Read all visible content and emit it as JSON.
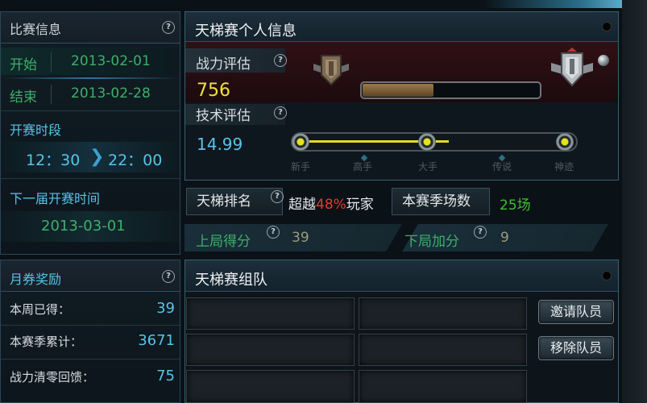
{
  "match_info": {
    "title": "比赛信息",
    "start_label": "开始",
    "start_date": "2013-02-01",
    "end_label": "结束",
    "end_date": "2013-02-28",
    "period_label": "开赛时段",
    "period_start": "12：30",
    "period_end": "22：00",
    "next_label": "下一届开赛时间",
    "next_date": "2013-03-01"
  },
  "voucher": {
    "title": "月券奖励",
    "rows": [
      {
        "label": "本周已得：",
        "value": "39"
      },
      {
        "label": "本赛季累计：",
        "value": "3671"
      },
      {
        "label": "战力清零回馈：",
        "value": "75"
      }
    ]
  },
  "ladder_personal": {
    "title": "天梯赛个人信息",
    "power_label": "战力评估",
    "power_value": "756",
    "power_fill": 0.4,
    "skill_label": "技术评估",
    "skill_value": "14.99",
    "skill_ticks": [
      "新手",
      "高手",
      "大手",
      "传说",
      "神迹"
    ],
    "rank_label": "天梯排名",
    "rank_prefix": "超越",
    "rank_percent": "48%",
    "rank_suffix": "玩家",
    "season_label": "本赛季场数",
    "season_value": "25场",
    "last_label": "上局得分",
    "last_value": "39",
    "next_bonus_label": "下局加分",
    "next_bonus_value": "9"
  },
  "team": {
    "title": "天梯赛组队",
    "invite_label": "邀请队员",
    "remove_label": "移除队员"
  },
  "colors": {
    "accent_blue": "#59c3e8",
    "green": "#3fae6b",
    "yellow": "#f0e23a",
    "red": "#e23b2f"
  }
}
